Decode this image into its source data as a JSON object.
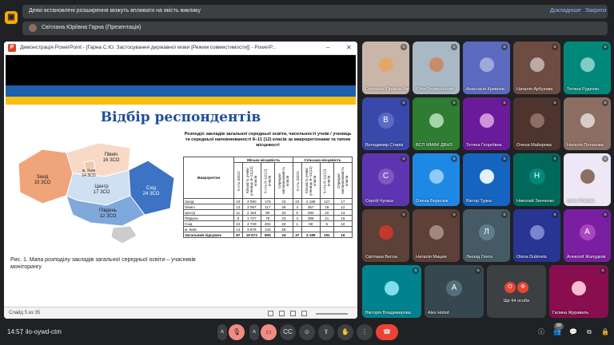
{
  "app_icon": "meet-logo-icon",
  "notice": {
    "text": "Деякі встановлені розширення можуть впливати на якість виклику",
    "details_link": "Докладніше",
    "close_link": "Закрити"
  },
  "presenter": {
    "label": "Світлана Юріївна Гарна (Презентація)"
  },
  "ppt": {
    "window_title": "Демонстрація PowerPoint - [Гарна С.Ю. Застосування державної мови [Режим совместимости]] - PowerP...",
    "slide_title": "Відбір респондентів",
    "status_text": "Слайд 5 из 35",
    "map_caption": "Рис. 1. Мапа розподілу закладів загальної середньої освіти – учасників моніторингу",
    "regions": [
      {
        "name": "Захід",
        "count": "33 ЗСО"
      },
      {
        "name": "Північ",
        "count": "16 ЗСО"
      },
      {
        "name": "м. Київ",
        "count": "14 ЗСО"
      },
      {
        "name": "Центр",
        "count": "17 ЗСО"
      },
      {
        "name": "Схід",
        "count": "24 ЗСО"
      },
      {
        "name": "Південь",
        "count": "12 ЗСО"
      }
    ],
    "table": {
      "title": "Розподіл закладів загальної середньої освіти, чисельності учнів / учениць та середньої наповнюваності 8–11 (12) класів за макрорегіонами та типом місцевості",
      "col_region": "Макрорегіон",
      "group_urban": "Міська місцевість",
      "group_rural": "Сільська місцевість",
      "sub_headers": [
        "К-сть ЗЗСО",
        "Кількість учнів/учениць 8–11(12) класів",
        "К-сть 8–11(12) класів",
        "Середня наповнюваність класів"
      ],
      "rows": [
        [
          "Захід",
          "19",
          "4 090",
          "176",
          "23",
          "23",
          "2 185",
          "127",
          "17"
        ],
        [
          "Північ",
          "13",
          "3 097",
          "117",
          "26",
          "4",
          "257",
          "19",
          "12"
        ],
        [
          "Центр",
          "11",
          "2 154",
          "90",
          "23",
          "5",
          "290",
          "22",
          "13"
        ],
        [
          "Південь",
          "8",
          "1 727",
          "76",
          "23",
          "4",
          "388",
          "21",
          "19"
        ],
        [
          "Схід",
          "22",
          "4 729",
          "202",
          "23",
          "1",
          "59",
          "6",
          "10"
        ],
        [
          "м. Київ",
          "14",
          "3 876",
          "144",
          "26",
          "",
          "",
          "",
          ""
        ],
        [
          "Загальний підсумок",
          "87",
          "19 673",
          "805",
          "24",
          "37",
          "3 189",
          "191",
          "16"
        ]
      ]
    }
  },
  "participants": [
    {
      "name": "Світлана Юріївна Гарна",
      "kind": "photo",
      "bg": "#c9b6a8",
      "color": "#e0a86c"
    },
    {
      "name": "Юлія Безвершенко",
      "kind": "photo",
      "bg": "#a8b8c4",
      "color": "#c98c6a"
    },
    {
      "name": "Анастасія Кривоніс",
      "kind": "photo",
      "bg": "#5c6bc0",
      "color": "#9fa8da"
    },
    {
      "name": "Наталія Арбузова",
      "kind": "photo",
      "bg": "#6d4c41",
      "color": "#bcaaa4"
    },
    {
      "name": "Тетяна Руденко",
      "kind": "photo",
      "bg": "#00897b",
      "color": "#80cbc4"
    },
    {
      "name": "Володимир Стирів",
      "kind": "letter",
      "letter": "В",
      "bg": "#3949ab",
      "color": "#5c6bc0"
    },
    {
      "name": "ВСП ММФК ДВНЗ",
      "kind": "photo",
      "bg": "#2e7d32",
      "color": "#a5d6a7"
    },
    {
      "name": "Тетяна Георгіївна",
      "kind": "photo",
      "bg": "#6a1b9a",
      "color": "#ce93d8"
    },
    {
      "name": "Олена Майорова",
      "kind": "photo",
      "bg": "#4e342e",
      "color": "#8d6e63"
    },
    {
      "name": "Наталія Потапова",
      "kind": "photo",
      "bg": "#8d6e63",
      "color": "#d7ccc8"
    },
    {
      "name": "Сергій Чугаєв",
      "kind": "letter",
      "letter": "С",
      "bg": "#5e35b1",
      "color": "#7e57c2"
    },
    {
      "name": "Олена Вересюк",
      "kind": "photo",
      "bg": "#1e88e5",
      "color": "#90caf9"
    },
    {
      "name": "Віктор Турка",
      "kind": "photo",
      "bg": "#1565c0",
      "color": "#e3f2fd"
    },
    {
      "name": "Николай Зинченко",
      "kind": "letter",
      "letter": "Н",
      "bg": "#00695c",
      "color": "#00897b"
    },
    {
      "name": "Ірина Ромова",
      "kind": "photo",
      "bg": "#ede7f6",
      "color": "#8d6e63"
    },
    {
      "name": "Світлана Весна",
      "kind": "photo",
      "bg": "#5d4037",
      "color": "#c0392b"
    },
    {
      "name": "Наталія Мацюк",
      "kind": "photo",
      "bg": "#5d4037",
      "color": "#a1887f"
    },
    {
      "name": "Леонід Гонта",
      "kind": "letter",
      "letter": "Л",
      "bg": "#455a64",
      "color": "#607d8b"
    },
    {
      "name": "Olena Dubinets",
      "kind": "photo",
      "bg": "#283593",
      "color": "#7986cb"
    },
    {
      "name": "Алексей Жалудков",
      "kind": "letter",
      "letter": "А",
      "bg": "#7b1fa2",
      "color": "#ab47bc"
    },
    {
      "name": "Вікторія Владимирова",
      "kind": "photo",
      "bg": "#00838f",
      "color": "#80deea"
    },
    {
      "name": "Alex Holod",
      "kind": "letter",
      "letter": "А",
      "bg": "#37474f",
      "color": "#546e7a"
    },
    {
      "name": "Ще 64 особи",
      "kind": "more",
      "bg": "#3c4043",
      "color": "#ea4335"
    },
    {
      "name": "Галина Журавель",
      "kind": "photo",
      "bg": "#880e4f",
      "color": "#f8bbd0"
    }
  ],
  "bottom_bar": {
    "time": "14:57",
    "separator": "|",
    "meeting_code": "ilo-oywd-ctm",
    "people_count": "88",
    "more_avatars": [
      "О",
      "Ф"
    ]
  },
  "colors": {
    "accent": "#8ab4f8",
    "danger": "#ea4335",
    "background": "#202124"
  }
}
